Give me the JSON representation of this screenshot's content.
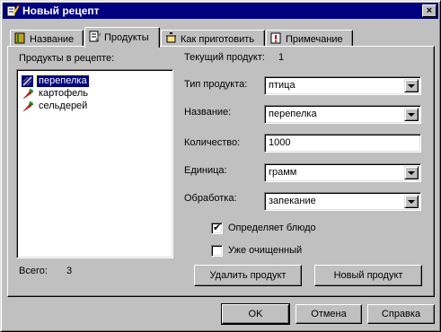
{
  "window": {
    "title": "Новый рецепт",
    "close_symbol": "×"
  },
  "tabs": [
    {
      "label": "Название",
      "icon": "book-icon"
    },
    {
      "label": "Продукты",
      "icon": "notepad-icon",
      "active": true
    },
    {
      "label": "Как приготовить",
      "icon": "pot-icon"
    },
    {
      "label": "Примечание",
      "icon": "exclamation-icon"
    }
  ],
  "products_list": {
    "label": "Продукты в рецепте:",
    "items": [
      {
        "label": "перепелка",
        "icon": "bird-icon",
        "selected": true
      },
      {
        "label": "картофель",
        "icon": "carrot-icon"
      },
      {
        "label": "сельдерей",
        "icon": "carrot-icon"
      }
    ],
    "total_label": "Всего:",
    "total_value": "3"
  },
  "current_product": {
    "label": "Текущий продукт:",
    "value": "1"
  },
  "form": {
    "type": {
      "label": "Тип продукта:",
      "value": "птица"
    },
    "name": {
      "label": "Название:",
      "value": "перепелка"
    },
    "quantity": {
      "label": "Количество:",
      "value": "1000"
    },
    "unit": {
      "label": "Единица:",
      "value": "грамм"
    },
    "processing": {
      "label": "Обработка:",
      "value": "запекание"
    },
    "defines_dish": {
      "label": "Определяет блюдо",
      "checked": true,
      "mark": "✔"
    },
    "already_peeled": {
      "label": "Уже очищенный",
      "checked": false
    }
  },
  "buttons": {
    "delete_product": "Удалить продукт",
    "new_product": "Новый продукт",
    "ok": "OK",
    "cancel": "Отмена",
    "help": "Справка"
  },
  "colors": {
    "titlebar": "#000080",
    "face": "#c0c0c0",
    "selection": "#000080"
  }
}
